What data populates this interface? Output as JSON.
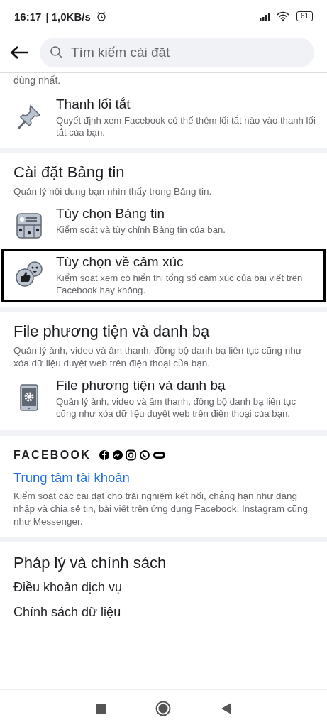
{
  "status_bar": {
    "time": "16:17",
    "speed": "| 1,0KB/s",
    "battery": "61"
  },
  "header": {
    "search": {
      "placeholder": "Tìm kiếm cài đặt"
    }
  },
  "cut_text": "dùng nhất.",
  "shortcut_item": {
    "title": "Thanh lối tắt",
    "description": "Quyết định xem Facebook có thể thêm lối tắt nào vào thanh lối tắt của bạn.",
    "highlighted": false
  },
  "sections": [
    {
      "title": "Cài đặt Bảng tin",
      "subtitle": "Quản lý nội dung bạn nhìn thấy trong Bảng tin.",
      "items": [
        {
          "title": "Tùy chọn Bảng tin",
          "description": "Kiểm soát và tùy chỉnh Bảng tin của bạn.",
          "highlighted": false
        },
        {
          "title": "Tùy chọn về cảm xúc",
          "description": "Kiểm soát xem có hiển thị tổng số cảm xúc của bài viết trên Facebook hay không.",
          "highlighted": true
        }
      ]
    },
    {
      "title": "File phương tiện và danh bạ",
      "subtitle": "Quản lý ảnh, video và âm thanh, đồng bộ danh bạ liên tục cũng như xóa dữ liệu duyệt web trên điện thoại của bạn.",
      "items": [
        {
          "title": "File phương tiện và danh bạ",
          "description": "Quản lý ảnh, video và âm thanh, đồng bộ danh bạ liên tục cũng như xóa dữ liệu duyệt web trên điện thoại của bạn.",
          "highlighted": false
        }
      ]
    }
  ],
  "facebook_section": {
    "brand": "FACEBOOK",
    "link": "Trung tâm tài khoản",
    "description": "Kiểm soát các cài đặt cho trải nghiệm kết nối, chẳng hạn như đăng nhập và chia sẻ tin, bài viết trên ứng dụng Facebook, Instagram cũng như Messenger."
  },
  "legal": {
    "title": "Pháp lý và chính sách",
    "links": [
      "Điều khoản dịch vụ",
      "Chính sách dữ liệu"
    ]
  }
}
